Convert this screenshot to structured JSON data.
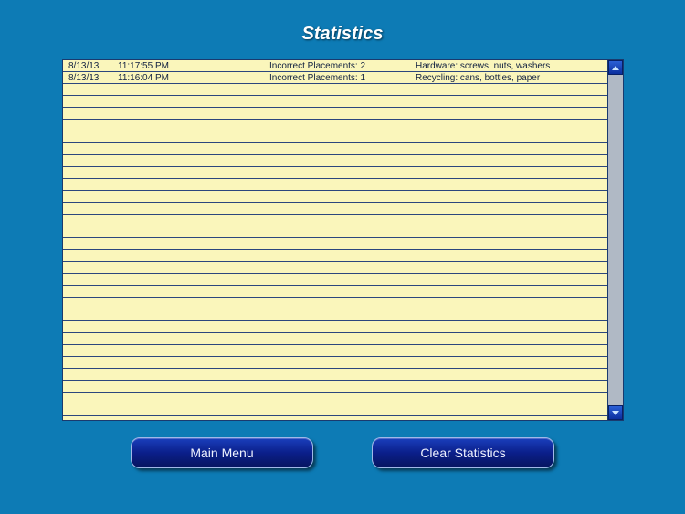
{
  "header": {
    "title": "Statistics"
  },
  "entries": [
    {
      "date": "8/13/13",
      "time": "11:17:55 PM",
      "result": "Incorrect Placements: 2",
      "description": "Hardware:  screws, nuts, washers"
    },
    {
      "date": "8/13/13",
      "time": "11:16:04 PM",
      "result": "Incorrect Placements: 1",
      "description": "Recycling: cans, bottles, paper"
    }
  ],
  "buttons": {
    "main_menu": "Main Menu",
    "clear_stats": "Clear Statistics"
  }
}
